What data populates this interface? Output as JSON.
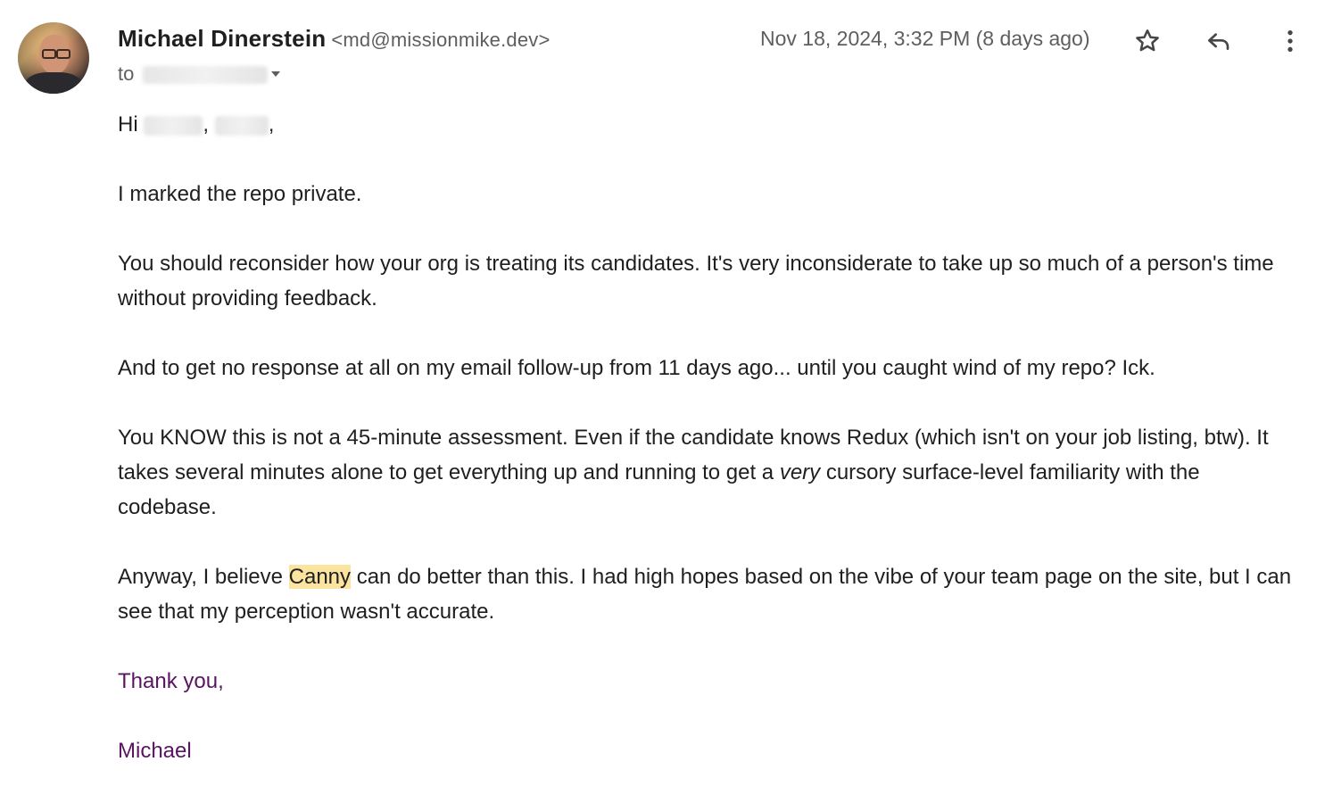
{
  "sender": {
    "name": "Michael Dinerstein",
    "email": "<md@missionmike.dev>",
    "avatar_icon": "user-avatar-photo"
  },
  "recipients": {
    "prefix": "to"
  },
  "timestamp": "Nov 18, 2024, 3:32 PM (8 days ago)",
  "actions": {
    "star_icon": "star-outline-icon",
    "reply_icon": "reply-arrow-icon",
    "more_icon": "vertical-dots-icon"
  },
  "body": {
    "greeting_prefix": "Hi",
    "greeting_sep": ",",
    "greeting_end": ",",
    "p1": "I marked the repo private.",
    "p2": "You should reconsider how your org is treating its candidates. It's very inconsiderate to take up so much of a person's time without providing feedback.",
    "p3": "And to get no response at all on my email follow-up from 11 days ago... until you caught wind of my repo? Ick.",
    "p4_a": "You KNOW this is not a 45-minute assessment. Even if the candidate knows Redux (which isn't on your job listing, btw). It takes several minutes alone to get everything up and running to get a ",
    "p4_em": "very",
    "p4_b": " cursory surface-level familiarity with the codebase.",
    "p5_a": "Anyway, I believe ",
    "p5_highlight": "Canny",
    "p5_b": " can do better than this. I had high hopes based on the vibe of your team page on the site, but I can see that my perception wasn't accurate.",
    "signoff": "Thank you,",
    "signature": "Michael"
  },
  "colors": {
    "highlight": "#fbe3a0",
    "signature": "#5b1463",
    "meta_text": "#5e5e5e"
  }
}
